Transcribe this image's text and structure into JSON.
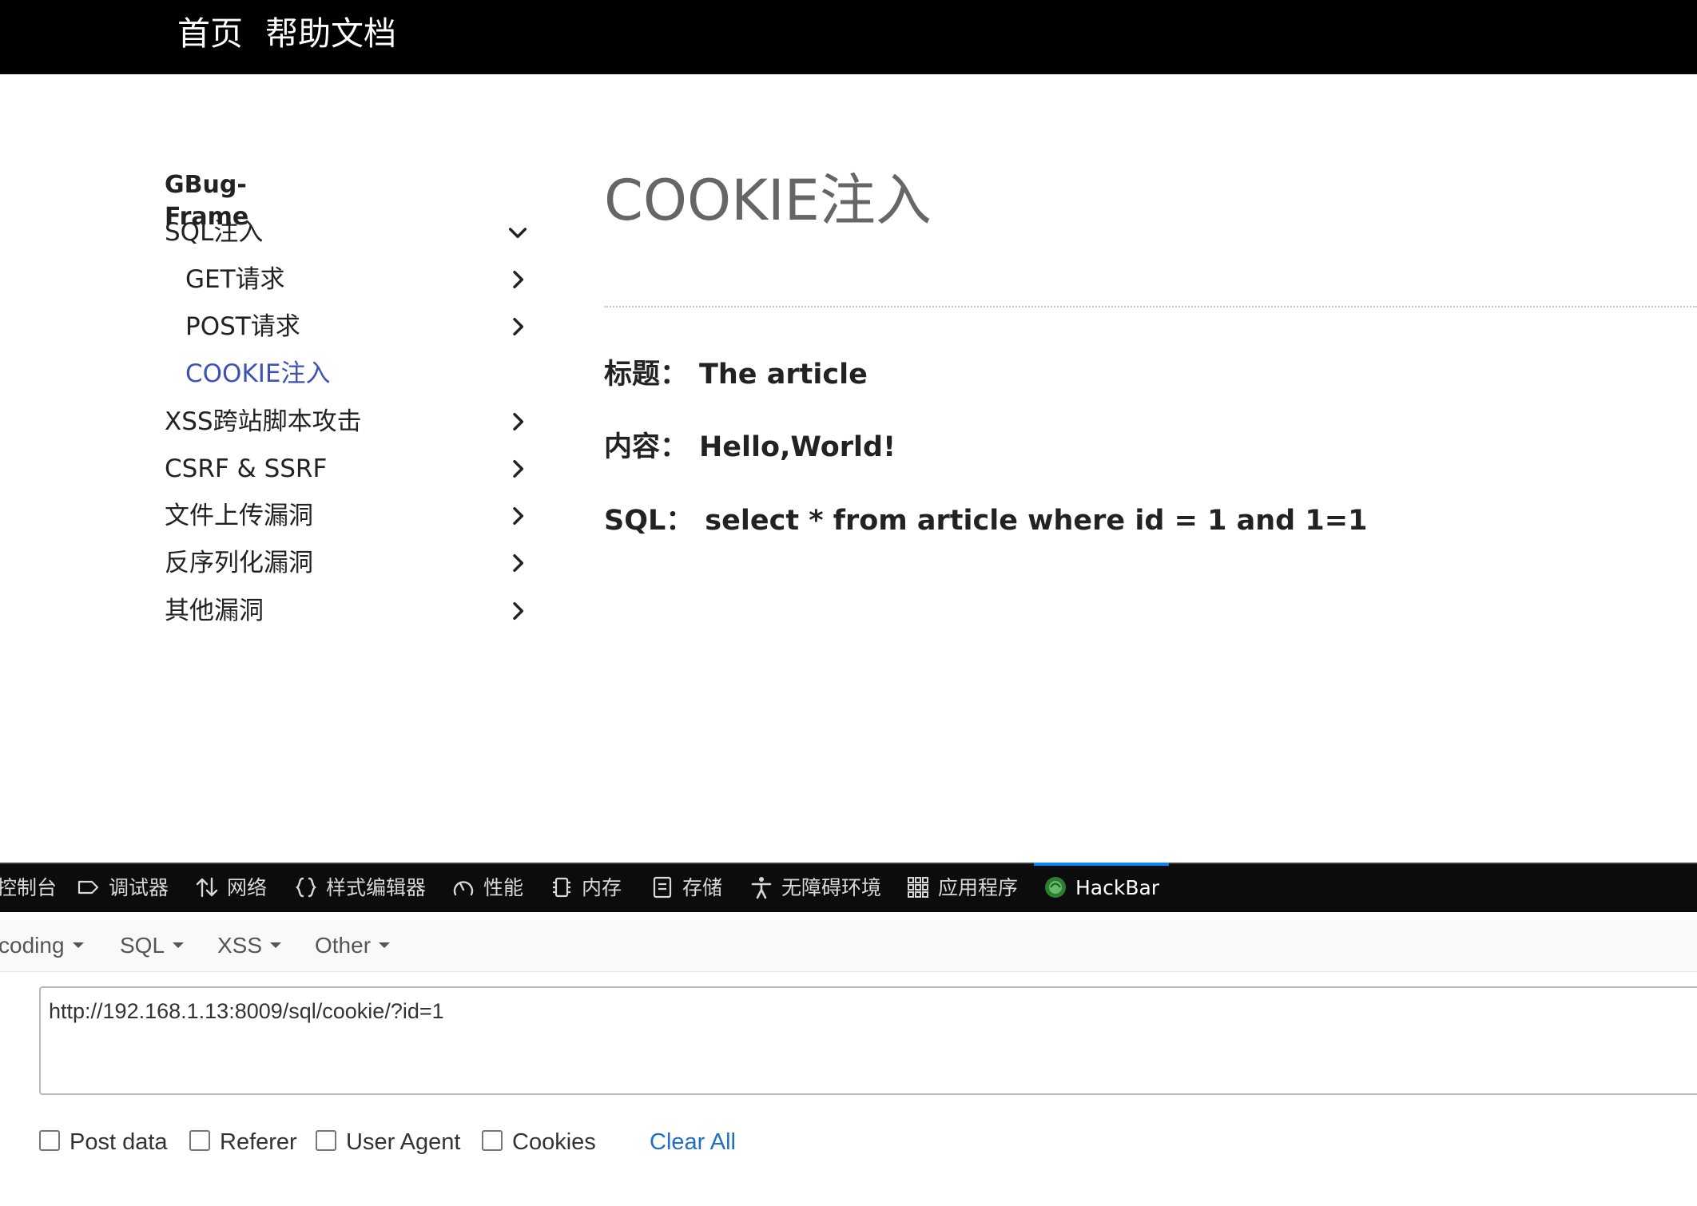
{
  "topnav": {
    "home": "首页",
    "docs": "帮助文档"
  },
  "sidebar": {
    "title": "GBug-Frame",
    "items": [
      {
        "label": "SQL注入",
        "chevron": "chevron-down-icon"
      },
      {
        "label": "GET请求",
        "chevron": "chevron-right-icon"
      },
      {
        "label": "POST请求",
        "chevron": "chevron-right-icon"
      },
      {
        "label": "COOKIE注入",
        "chevron": "none"
      },
      {
        "label": "XSS跨站脚本攻击",
        "chevron": "chevron-right-icon"
      },
      {
        "label": "CSRF & SSRF",
        "chevron": "chevron-right-icon"
      },
      {
        "label": "文件上传漏洞",
        "chevron": "chevron-right-icon"
      },
      {
        "label": "反序列化漏洞",
        "chevron": "chevron-right-icon"
      },
      {
        "label": "其他漏洞",
        "chevron": "chevron-right-icon"
      }
    ],
    "active_color": "#3f51b5"
  },
  "main": {
    "title": "COOKIE注入",
    "rows": [
      {
        "key": "标题：",
        "value": "The article"
      },
      {
        "key": "内容：",
        "value": "Hello,World!"
      },
      {
        "key": "SQL：",
        "value": "select * from article where id = 1 and 1=1"
      }
    ]
  },
  "devtools": {
    "tabs": [
      {
        "label": "控制台",
        "icon": "console-icon"
      },
      {
        "label": "调试器",
        "icon": "debugger-icon"
      },
      {
        "label": "网络",
        "icon": "network-arrows-icon"
      },
      {
        "label": "样式编辑器",
        "icon": "braces-icon"
      },
      {
        "label": "性能",
        "icon": "gauge-icon"
      },
      {
        "label": "内存",
        "icon": "memory-chip-icon"
      },
      {
        "label": "存储",
        "icon": "storage-icon"
      },
      {
        "label": "无障碍环境",
        "icon": "accessibility-icon"
      },
      {
        "label": "应用程序",
        "icon": "grid-apps-icon"
      },
      {
        "label": "HackBar",
        "icon": "hackbar-logo-icon",
        "active": true
      }
    ],
    "active_tab_color": "#0a84ff",
    "hackbar": {
      "menus": [
        "coding",
        "SQL",
        "XSS",
        "Other"
      ],
      "url": "http://192.168.1.13:8009/sql/cookie/?id=1",
      "options": [
        "Post data",
        "Referer",
        "User Agent",
        "Cookies"
      ],
      "clear_all": "Clear All"
    }
  }
}
